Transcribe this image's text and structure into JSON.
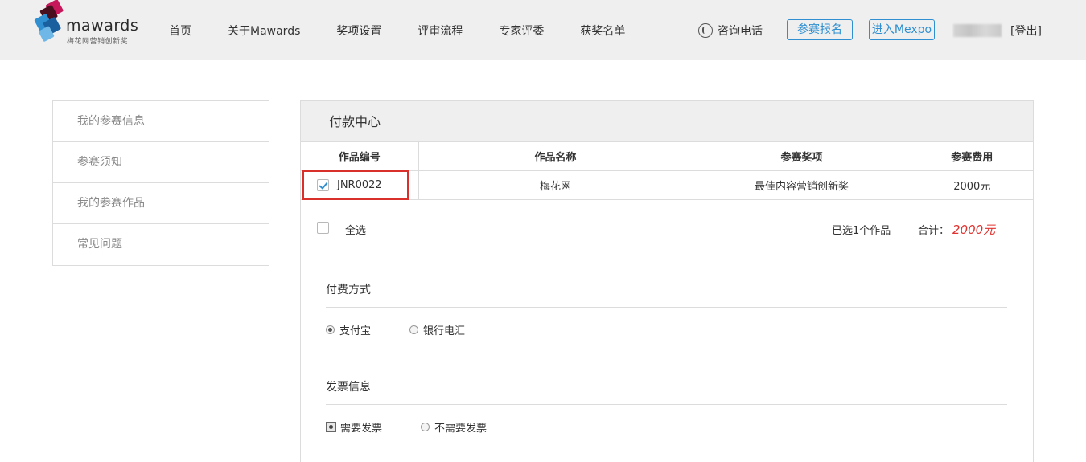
{
  "header": {
    "logo_text": "mawards",
    "logo_tagline": "梅花网营销创新奖",
    "nav": [
      "首页",
      "关于Mawards",
      "奖项设置",
      "评审流程",
      "专家评委",
      "获奖名单"
    ],
    "phone_label": "咨询电话",
    "register_button": "参赛报名",
    "mexpo_button": "进入Mexpo",
    "logout_label": "[登出]"
  },
  "sidebar": {
    "items": [
      "我的参赛信息",
      "参赛须知",
      "我的参赛作品",
      "常见问题"
    ]
  },
  "panel": {
    "title": "付款中心",
    "table": {
      "headers": [
        "作品编号",
        "作品名称",
        "参赛奖项",
        "参赛费用"
      ],
      "rows": [
        {
          "id": "JNR0022",
          "name": "梅花网",
          "award": "最佳内容营销创新奖",
          "fee": "2000元",
          "checked": true
        }
      ]
    },
    "select_all_label": "全选",
    "selected_count": "已选1个作品",
    "total_label": "合计：",
    "total_value": "2000元",
    "payment": {
      "title": "付费方式",
      "options": [
        "支付宝",
        "银行电汇"
      ],
      "selected": "支付宝"
    },
    "invoice": {
      "title": "发票信息",
      "options": [
        "需要发票",
        "不需要发票"
      ],
      "selected": "需要发票"
    }
  },
  "colors": {
    "accent": "#2f8fd0",
    "highlight": "#d9302c",
    "total": "#e0322e",
    "header_bg": "#efefef"
  }
}
